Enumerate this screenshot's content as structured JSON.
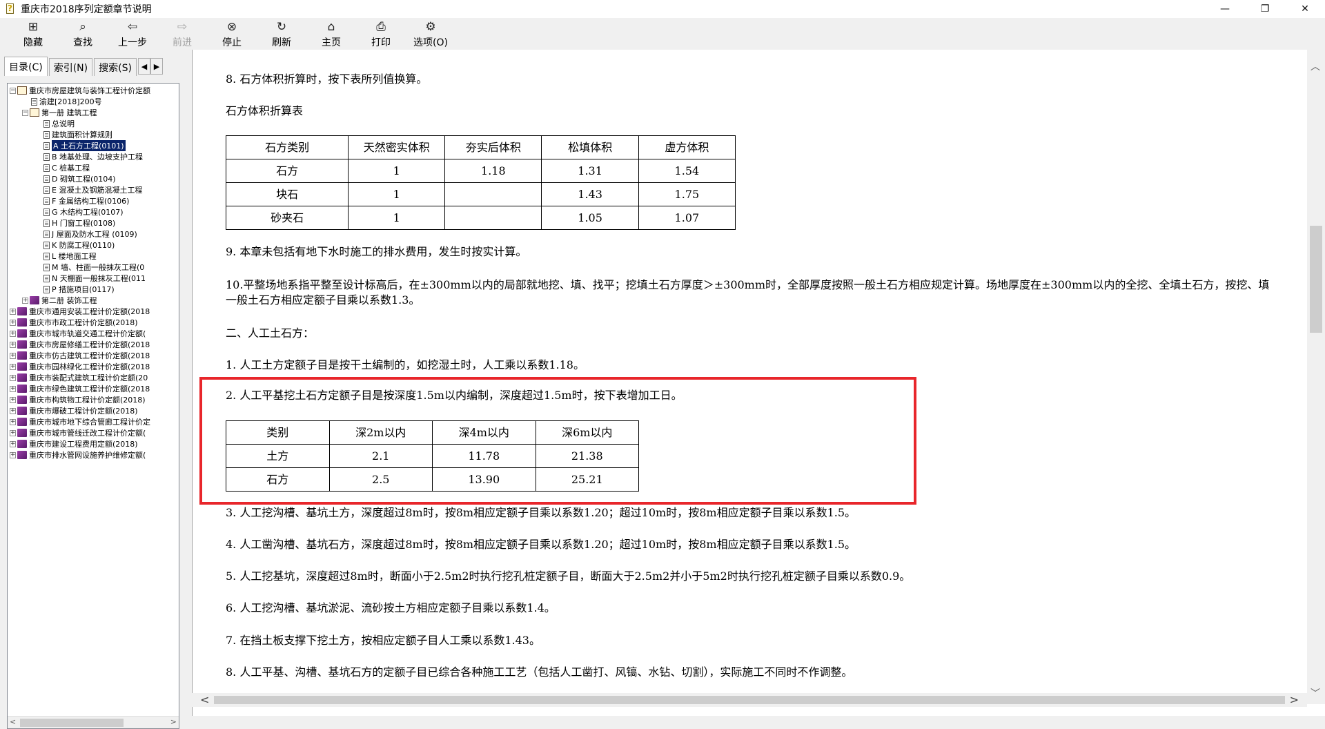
{
  "window": {
    "title": "重庆市2018序列定额章节说明",
    "controls": [
      "—",
      "❐",
      "✕"
    ]
  },
  "toolbar": [
    {
      "label": "隐藏",
      "icon": "hide-icon",
      "glyph": "⊞",
      "enabled": true
    },
    {
      "label": "查找",
      "icon": "find-icon",
      "glyph": "⌕",
      "enabled": true
    },
    {
      "label": "上一步",
      "icon": "back-icon",
      "glyph": "⇦",
      "enabled": true
    },
    {
      "label": "前进",
      "icon": "forward-icon",
      "glyph": "⇨",
      "enabled": false
    },
    {
      "label": "停止",
      "icon": "stop-icon",
      "glyph": "⊗",
      "enabled": true
    },
    {
      "label": "刷新",
      "icon": "refresh-icon",
      "glyph": "↻",
      "enabled": true
    },
    {
      "label": "主页",
      "icon": "home-icon",
      "glyph": "⌂",
      "enabled": true
    },
    {
      "label": "打印",
      "icon": "print-icon",
      "glyph": "⎙",
      "enabled": true
    },
    {
      "label": "选项(O)",
      "icon": "options-icon",
      "glyph": "⚙",
      "enabled": true
    }
  ],
  "tabs": {
    "contents": "目录(C)",
    "index": "索引(N)",
    "search": "搜索(S)"
  },
  "tree": [
    {
      "depth": 0,
      "exp": "−",
      "icon": "open",
      "text": "重庆市房屋建筑与装饰工程计价定额"
    },
    {
      "depth": 1,
      "exp": "",
      "icon": "doc",
      "text": "渝建[2018]200号"
    },
    {
      "depth": 1,
      "exp": "−",
      "icon": "open",
      "text": "第一册 建筑工程"
    },
    {
      "depth": 2,
      "exp": "",
      "icon": "doc",
      "text": "总说明"
    },
    {
      "depth": 2,
      "exp": "",
      "icon": "doc",
      "text": "建筑面积计算规则"
    },
    {
      "depth": 2,
      "exp": "",
      "icon": "doc",
      "text": "A 土石方工程(0101)",
      "selected": true
    },
    {
      "depth": 2,
      "exp": "",
      "icon": "doc",
      "text": "B 地基处理、边坡支护工程"
    },
    {
      "depth": 2,
      "exp": "",
      "icon": "doc",
      "text": "C 桩基工程"
    },
    {
      "depth": 2,
      "exp": "",
      "icon": "doc",
      "text": "D 砌筑工程(0104)"
    },
    {
      "depth": 2,
      "exp": "",
      "icon": "doc",
      "text": "E 混凝土及钢筋混凝土工程"
    },
    {
      "depth": 2,
      "exp": "",
      "icon": "doc",
      "text": "F 金属结构工程(0106)"
    },
    {
      "depth": 2,
      "exp": "",
      "icon": "doc",
      "text": "G 木结构工程(0107)"
    },
    {
      "depth": 2,
      "exp": "",
      "icon": "doc",
      "text": "H 门窗工程(0108)"
    },
    {
      "depth": 2,
      "exp": "",
      "icon": "doc",
      "text": "J 屋面及防水工程 (0109)"
    },
    {
      "depth": 2,
      "exp": "",
      "icon": "doc",
      "text": "K 防腐工程(0110)"
    },
    {
      "depth": 2,
      "exp": "",
      "icon": "doc",
      "text": "L 楼地面工程"
    },
    {
      "depth": 2,
      "exp": "",
      "icon": "doc",
      "text": "M 墙、柱面一般抹灰工程(0"
    },
    {
      "depth": 2,
      "exp": "",
      "icon": "doc",
      "text": "N 天棚面一般抹灰工程(011"
    },
    {
      "depth": 2,
      "exp": "",
      "icon": "doc",
      "text": "P 措施项目(0117)"
    },
    {
      "depth": 1,
      "exp": "+",
      "icon": "purple",
      "text": "第二册 装饰工程"
    },
    {
      "depth": 0,
      "exp": "+",
      "icon": "purple",
      "text": "重庆市通用安装工程计价定额(2018"
    },
    {
      "depth": 0,
      "exp": "+",
      "icon": "purple",
      "text": "重庆市市政工程计价定额(2018)"
    },
    {
      "depth": 0,
      "exp": "+",
      "icon": "purple",
      "text": "重庆市城市轨道交通工程计价定额("
    },
    {
      "depth": 0,
      "exp": "+",
      "icon": "purple",
      "text": "重庆市房屋修缮工程计价定额(2018"
    },
    {
      "depth": 0,
      "exp": "+",
      "icon": "purple",
      "text": "重庆市仿古建筑工程计价定额(2018"
    },
    {
      "depth": 0,
      "exp": "+",
      "icon": "purple",
      "text": "重庆市园林绿化工程计价定额(2018"
    },
    {
      "depth": 0,
      "exp": "+",
      "icon": "purple",
      "text": "重庆市装配式建筑工程计价定额(20"
    },
    {
      "depth": 0,
      "exp": "+",
      "icon": "purple",
      "text": "重庆市绿色建筑工程计价定额(2018"
    },
    {
      "depth": 0,
      "exp": "+",
      "icon": "purple",
      "text": "重庆市构筑物工程计价定额(2018)"
    },
    {
      "depth": 0,
      "exp": "+",
      "icon": "purple",
      "text": "重庆市爆破工程计价定额(2018)"
    },
    {
      "depth": 0,
      "exp": "+",
      "icon": "purple",
      "text": "重庆市城市地下综合管廊工程计价定"
    },
    {
      "depth": 0,
      "exp": "+",
      "icon": "purple",
      "text": "重庆市城市管线迁改工程计价定额("
    },
    {
      "depth": 0,
      "exp": "+",
      "icon": "purple",
      "text": "重庆市建设工程费用定额(2018)"
    },
    {
      "depth": 0,
      "exp": "+",
      "icon": "purple",
      "text": "重庆市排水管网设施养护维修定额("
    }
  ],
  "content": {
    "p8": "8. 石方体积折算时，按下表所列值换算。",
    "table1_title": "石方体积折算表",
    "table1": {
      "headers": [
        "石方类别",
        "天然密实体积",
        "夯实后体积",
        "松填体积",
        "虚方体积"
      ],
      "rows": [
        [
          "石方",
          "1",
          "1.18",
          "1.31",
          "1.54"
        ],
        [
          "块石",
          "1",
          "",
          "1.43",
          "1.75"
        ],
        [
          "砂夹石",
          "1",
          "",
          "1.05",
          "1.07"
        ]
      ]
    },
    "p9": "9. 本章未包括有地下水时施工的排水费用，发生时按实计算。",
    "p10": "10.平整场地系指平整至设计标高后，在±300mm以内的局部就地挖、填、找平；挖填土石方厚度＞±300mm时，全部厚度按照一般土石方相应规定计算。场地厚度在±300mm以内的全挖、全填土石方，按挖、填一般土石方相应定额子目乘以系数1.3。",
    "sec2": "二、人工土石方：",
    "q1": "1. 人工土方定额子目是按干土编制的，如挖湿土时，人工乘以系数1.18。",
    "q2": "2. 人工平基挖土石方定额子目是按深度1.5m以内编制，深度超过1.5m时，按下表增加工日。",
    "table2": {
      "headers": [
        "类别",
        "深2m以内",
        "深4m以内",
        "深6m以内"
      ],
      "rows": [
        [
          "土方",
          "2.1",
          "11.78",
          "21.38"
        ],
        [
          "石方",
          "2.5",
          "13.90",
          "25.21"
        ]
      ]
    },
    "q3": "3. 人工挖沟槽、基坑土方，深度超过8m时，按8m相应定额子目乘以系数1.20；超过10m时，按8m相应定额子目乘以系数1.5。",
    "q4": "4. 人工凿沟槽、基坑石方，深度超过8m时，按8m相应定额子目乘以系数1.20；超过10m时，按8m相应定额子目乘以系数1.5。",
    "q5": "5. 人工挖基坑，深度超过8m时，断面小于2.5m2时执行挖孔桩定额子目，断面大于2.5m2并小于5m2时执行挖孔桩定额子目乘以系数0.9。",
    "q6": "6. 人工挖沟槽、基坑淤泥、流砂按土方相应定额子目乘以系数1.4。",
    "q7": "7. 在挡土板支撑下挖土方，按相应定额子目人工乘以系数1.43。",
    "q8": "8. 人工平基、沟槽、基坑石方的定额子目已综合各种施工工艺（包括人工凿打、风镐、水钻、切割），实际施工不同时不作调整。"
  }
}
